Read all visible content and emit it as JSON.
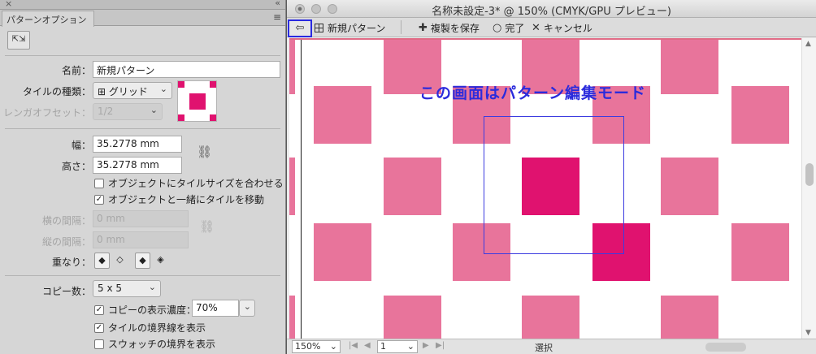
{
  "panel": {
    "tab_label": "パターンオプション",
    "close_glyph": "×",
    "collapse_glyph": "«",
    "menu_glyph": "≡",
    "tile_tool_glyph": "⇱⇲",
    "name_label": "名前：",
    "name_value": "新規パターン",
    "tile_type_label": "タイルの種類：",
    "tile_type_value": "グリッド",
    "brick_offset_label": "レンガオフセット：",
    "brick_offset_value": "1/2",
    "width_label": "幅：",
    "width_value": "35.2778 mm",
    "height_label": "高さ：",
    "height_value": "35.2778 mm",
    "chk_size_to_art": "オブジェクトにタイルサイズを合わせる",
    "chk_move_with_art": "オブジェクトと一緒にタイルを移動",
    "h_spacing_label": "横の間隔：",
    "h_spacing_value": "0 mm",
    "v_spacing_label": "縦の間隔：",
    "v_spacing_value": "0 mm",
    "overlap_label": "重なり：",
    "copies_label": "コピー数：",
    "copies_value": "5 x 5",
    "chk_dim_copies": "コピーの表示濃度：",
    "dim_value": "70%",
    "chk_show_tile_edge": "タイルの境界線を表示",
    "chk_show_swatch_bounds": "スウォッチの境界を表示"
  },
  "document": {
    "title": "名称未設定-3* @ 150% (CMYK/GPU プレビュー)",
    "back_glyph": "⇦",
    "pattern_name": "新規パターン",
    "save_copy": "複製を保存",
    "done": "完了",
    "cancel": "キャンセル",
    "annotation": "この画面はパターン編集モード"
  },
  "status": {
    "zoom": "150%",
    "page": "1",
    "mode": "選択"
  },
  "colors": {
    "tile_light": "#e8749b",
    "tile_hot": "#e0126f",
    "accent_blue": "#2b2bdc"
  }
}
